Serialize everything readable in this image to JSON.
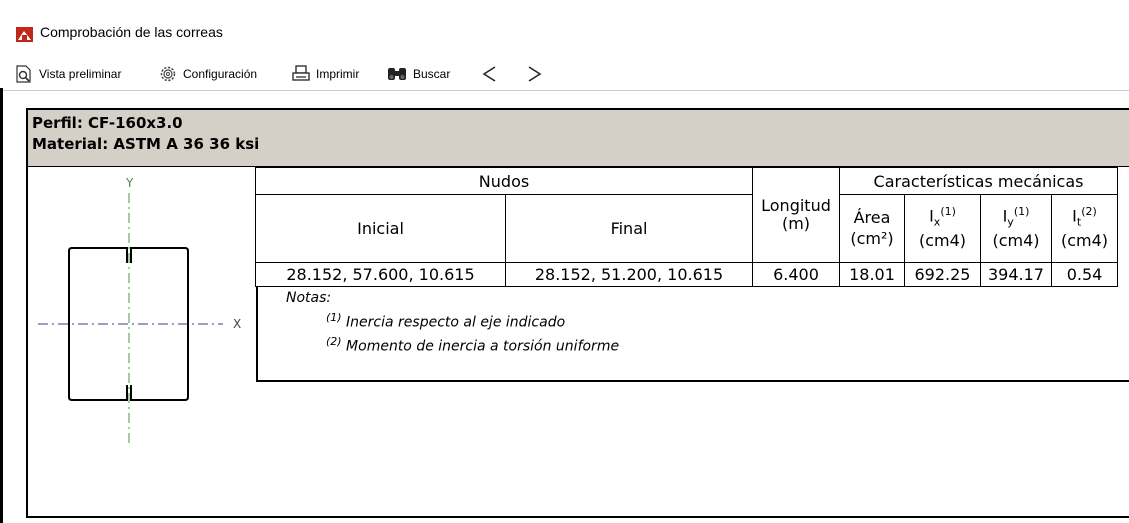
{
  "window": {
    "title": "Comprobación de las correas"
  },
  "toolbar": {
    "preview_label": "Vista preliminar",
    "config_label": "Configuración",
    "print_label": "Imprimir",
    "search_label": "Buscar"
  },
  "report": {
    "profile": "Perfil: CF-160x3.0",
    "material": "Material: ASTM A 36 36 ksi",
    "section": {
      "axis_y": "Y",
      "axis_x": "X"
    },
    "table": {
      "nodes_header": "Nudos",
      "initial_header": "Inicial",
      "final_header": "Final",
      "length_header_1": "Longitud",
      "length_header_2": "(m)",
      "mech_header": "Características mecánicas",
      "area_header_1": "Área",
      "area_header_2": "(cm²)",
      "ix_sym": "I",
      "ix_sub": "x",
      "ix_sup": "(1)",
      "iy_sym": "I",
      "iy_sub": "y",
      "iy_sup": "(1)",
      "it_sym": "I",
      "it_sub": "t",
      "it_sup": "(2)",
      "unit_cm4": "(cm4)",
      "row": {
        "initial": "28.152, 57.600, 10.615",
        "final": "28.152, 51.200, 10.615",
        "length": "6.400",
        "area": "18.01",
        "ix": "692.25",
        "iy": "394.17",
        "it": "0.54"
      }
    },
    "notes": {
      "title": "Notas:",
      "note1_sup": "(1)",
      "note1": "Inercia respecto al eje indicado",
      "note2_sup": "(2)",
      "note2": "Momento de inercia a torsión uniforme"
    }
  }
}
